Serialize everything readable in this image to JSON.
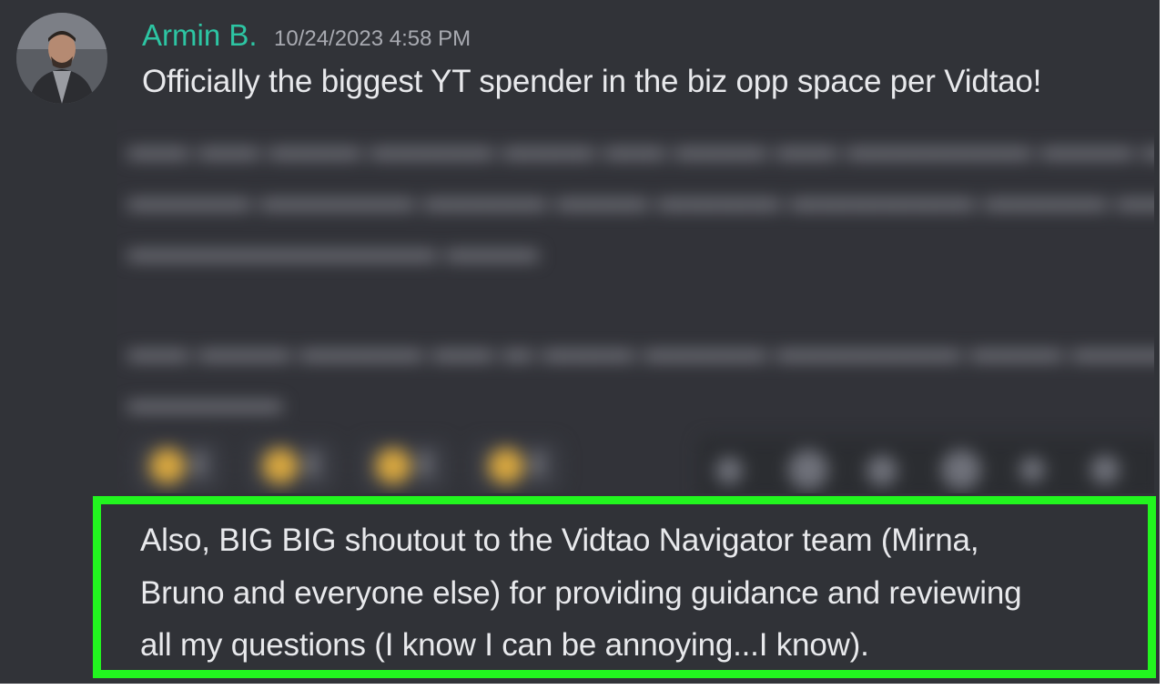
{
  "message": {
    "username": "Armin B.",
    "timestamp": "10/24/2023 4:58 PM",
    "text": "Officially the biggest YT spender in the biz opp space per Vidtao!",
    "avatar_icon": "user-avatar-photo"
  },
  "highlight": {
    "border_color": "#22f51f",
    "lines": [
      "Also, BIG BIG shoutout to the Vidtao Navigator team (Mirna,",
      "Bruno and everyone else) for providing guidance and reviewing",
      "all my questions (I know I can be annoying...I know)."
    ]
  },
  "colors": {
    "background": "#313338",
    "username": "#2dc5a3",
    "timestamp": "#a8aab1",
    "text": "#e8e9ec"
  }
}
